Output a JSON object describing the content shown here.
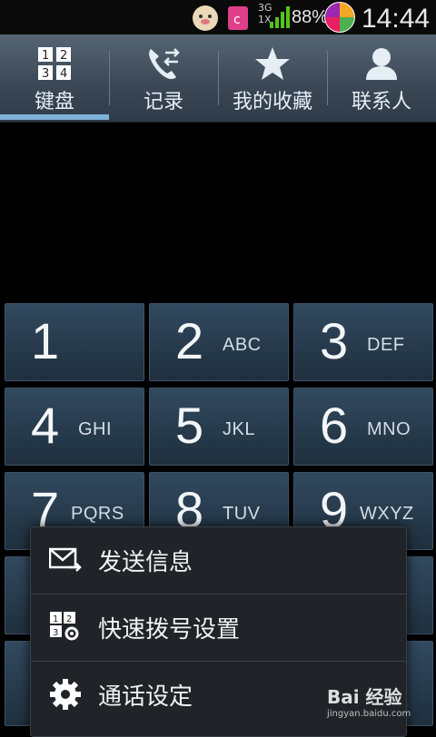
{
  "status_bar": {
    "network_top": "3G",
    "network_bottom": "1X",
    "battery_percent": "88%",
    "time": "14:44"
  },
  "tabs": [
    {
      "label": "键盘",
      "icon": "keypad-icon",
      "selected": true
    },
    {
      "label": "记录",
      "icon": "call-log-icon",
      "selected": false
    },
    {
      "label": "我的收藏",
      "icon": "star-icon",
      "selected": false
    },
    {
      "label": "联系人",
      "icon": "person-icon",
      "selected": false
    }
  ],
  "keys": [
    {
      "digit": "1",
      "letters": ""
    },
    {
      "digit": "2",
      "letters": "ABC"
    },
    {
      "digit": "3",
      "letters": "DEF"
    },
    {
      "digit": "4",
      "letters": "GHI"
    },
    {
      "digit": "5",
      "letters": "JKL"
    },
    {
      "digit": "6",
      "letters": "MNO"
    },
    {
      "digit": "7",
      "letters": "PQRS"
    },
    {
      "digit": "8",
      "letters": "TUV"
    },
    {
      "digit": "9",
      "letters": "WXYZ"
    }
  ],
  "menu": {
    "items": [
      {
        "label": "发送信息",
        "icon": "message-icon"
      },
      {
        "label": "快速拨号设置",
        "icon": "speed-dial-settings-icon"
      },
      {
        "label": "通话设定",
        "icon": "gear-icon"
      }
    ]
  },
  "watermark": {
    "text": "Bai 经验",
    "sub": "jingyan.baidu.com"
  },
  "colors": {
    "tab_indicator": "#7fb3d9",
    "key_bg": "#2b4054",
    "menu_bg": "#202428"
  }
}
